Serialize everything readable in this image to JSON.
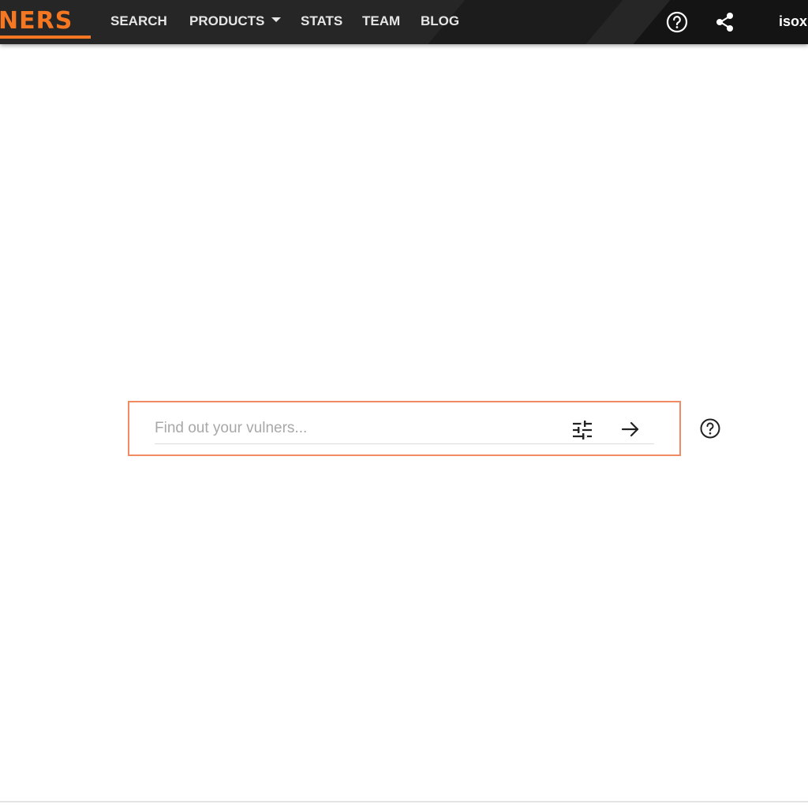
{
  "brand": {
    "logo_text": "NERS",
    "accent_color": "#f57722"
  },
  "nav": {
    "items": [
      {
        "label": "SEARCH"
      },
      {
        "label": "PRODUCTS",
        "has_dropdown": true
      },
      {
        "label": "STATS"
      },
      {
        "label": "TEAM"
      },
      {
        "label": "BLOG"
      }
    ]
  },
  "header_icons": {
    "help": "help-circle-icon",
    "share": "share-icon"
  },
  "user": {
    "label": "isox"
  },
  "search": {
    "placeholder": "Find out your vulners...",
    "value": "",
    "filter_icon": "tune-icon",
    "submit_icon": "arrow-right-icon",
    "help_icon": "help-circle-icon",
    "highlight_color": "#f08a63"
  }
}
